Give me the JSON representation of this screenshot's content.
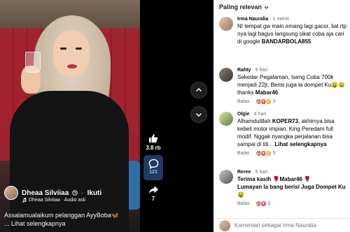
{
  "video": {
    "creator_name": "Dheaa Silviiaa",
    "verified_icon": "clock-icon",
    "follow_label": "Ikuti",
    "audio_text": "Dheaa Silviiaa · Audio asli",
    "caption_line1": "Assalamualaikum pelanggan AyyBoba🦋",
    "caption_line2": "... Lihat selengkapnya"
  },
  "actions": {
    "like_count": "3.8 rb",
    "comment_count": "121",
    "share_count": "7"
  },
  "comments_panel": {
    "sort_label": "Paling relevan",
    "reply_label": "Balas",
    "input_placeholder": "Komentari sebagai Irma Nauralia",
    "comments": [
      {
        "author": "Irma Nauralia",
        "time": "· 1 menit",
        "text_a": "NI tempat gw main emang lagi gacor, liat rtp nya lagi bagus langsung sikat coba aja cari di google ",
        "text_b": "BANDARBOLA855",
        "reaction_count": ""
      },
      {
        "author": "Rahty",
        "time": "· 5 hari",
        "text_a": "Sekedar Pegalaman, Iseng Coba 700k menjadi 22jt, Berisi juga la dompet Ku🤑😄thanks ",
        "text_b": "Mabar46",
        "reaction_count": "3"
      },
      {
        "author": "Olgie",
        "time": "· 4 hari",
        "text_a": "Alhamdulillah ",
        "text_b": "KOPER73",
        "text_c": ", akhirnya bisa kebeli motor impian, King Peredam full modif. Nggak nyangka perjalanan bisa sampai di titi... ",
        "text_d": "Lihat selengkapnya",
        "reaction_count": "3"
      },
      {
        "author": "Reree",
        "time": "· 5 hari",
        "text_a": "Terima kasih 🌹Mabar46 🌹",
        "text_b": "Lumayan la bang berisi Juga Dompet Ku🤑",
        "reaction_count": "3"
      }
    ]
  },
  "colors": {
    "panel_bg": "#ffffff",
    "link_blue": "#1877f2",
    "page_bg": "#000000"
  }
}
